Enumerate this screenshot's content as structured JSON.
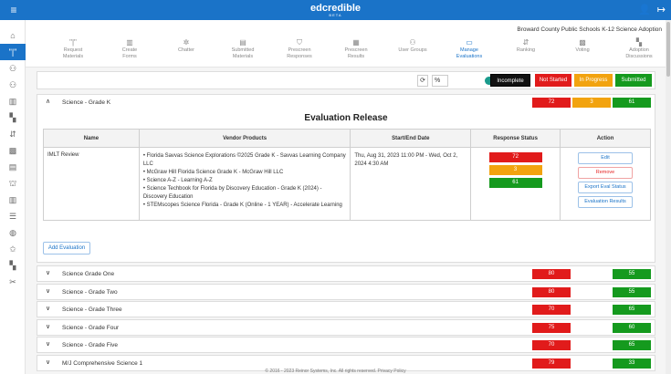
{
  "app": {
    "logo_text": "edcredible",
    "logo_sub": "BETA",
    "menu_icon": "≡",
    "user_icon": "👤",
    "logout_icon": "↦"
  },
  "header": {
    "district": "Broward County Public Schools K-12 Science Adoption"
  },
  "nav": [
    {
      "label1": "Request",
      "label2": "Materials",
      "icon": "\"|\"",
      "active": false
    },
    {
      "label1": "Create",
      "label2": "Forms",
      "icon": "▥",
      "active": false
    },
    {
      "label1": "Chatter",
      "label2": "",
      "icon": "✲",
      "active": false
    },
    {
      "label1": "Submitted",
      "label2": "Materials",
      "icon": "▤",
      "active": false
    },
    {
      "label1": "Prescreen",
      "label2": "Responses",
      "icon": "⛉",
      "active": false
    },
    {
      "label1": "Prescreen",
      "label2": "Results",
      "icon": "▦",
      "active": false
    },
    {
      "label1": "User Groups",
      "label2": "",
      "icon": "⚇",
      "active": false
    },
    {
      "label1": "Manage",
      "label2": "Evaluations",
      "icon": "▭",
      "active": true
    },
    {
      "label1": "Ranking",
      "label2": "",
      "icon": "⇵",
      "active": false
    },
    {
      "label1": "Voting",
      "label2": "",
      "icon": "▩",
      "active": false
    },
    {
      "label1": "Adoption",
      "label2": "Discussions",
      "icon": "▚",
      "active": false
    }
  ],
  "sidebar_icons": [
    "⌂",
    "\"|\"",
    "⚇",
    "⚇",
    "▥",
    "▚",
    "⇵",
    "▩",
    "▤",
    "⛫",
    "▥",
    "☰",
    "◍",
    "✩",
    "▚",
    "✂"
  ],
  "filters": {
    "refresh_icon": "⟳",
    "percent_label": "%",
    "count_label": "count",
    "chips": [
      {
        "label": "Incomplete",
        "color": "#111111"
      },
      {
        "label": "Not Started",
        "color": "#e11b1b"
      },
      {
        "label": "In Progress",
        "color": "#f2a30f"
      },
      {
        "label": "Submitted",
        "color": "#159a1e"
      }
    ]
  },
  "expanded_grade": {
    "name": "Science - Grade K",
    "chevron": "∧",
    "counts": [
      {
        "value": "72",
        "color": "#e11b1b"
      },
      {
        "value": "3",
        "color": "#f2a30f"
      },
      {
        "value": "61",
        "color": "#159a1e"
      }
    ]
  },
  "release": {
    "title": "Evaluation Release",
    "columns": [
      "Name",
      "Vendor Products",
      "Start/End Date",
      "Response Status",
      "Action"
    ],
    "row": {
      "name": "IMLT Review",
      "products": [
        "• Florida Savvas Science Explorations ©2025 Grade K - Savvas Learning Company LLC",
        "• McGraw Hill Florida Science Grade K - McGraw Hill LLC",
        "• Science A-Z - Learning A-Z",
        "• Science Techbook for Florida by Discovery Education - Grade K (2024) - Discovery Education",
        "• STEMscopes Science Florida - Grade K (Online - 1 YEAR) - Accelerate Learning"
      ],
      "date": "Thu, Aug 31, 2023 11:00 PM - Wed, Oct 2, 2024 4:30 AM",
      "status": [
        {
          "value": "72",
          "color": "#e11b1b"
        },
        {
          "value": "3",
          "color": "#f2a30f"
        },
        {
          "value": "61",
          "color": "#159a1e"
        }
      ],
      "actions": {
        "edit": "Edit",
        "remove": "Remove",
        "export": "Export Eval Status",
        "results": "Evaluation Results"
      }
    },
    "add_label": "Add Evaluation"
  },
  "grades": [
    {
      "name": "Science Grade One",
      "chevron": "∨",
      "red": "80",
      "green": "55"
    },
    {
      "name": "Science - Grade Two",
      "chevron": "∨",
      "red": "80",
      "green": "55"
    },
    {
      "name": "Science - Grade Three",
      "chevron": "∨",
      "red": "70",
      "green": "65"
    },
    {
      "name": "Science - Grade Four",
      "chevron": "∨",
      "red": "75",
      "green": "60"
    },
    {
      "name": "Science - Grade Five",
      "chevron": "∨",
      "red": "70",
      "green": "65"
    },
    {
      "name": "M/J Comprehensive Science 1",
      "chevron": "∨",
      "red": "79",
      "green": "33"
    }
  ],
  "footer": "© 2016 - 2023 Reinor Systems, Inc. All rights reserved. Privacy Policy"
}
